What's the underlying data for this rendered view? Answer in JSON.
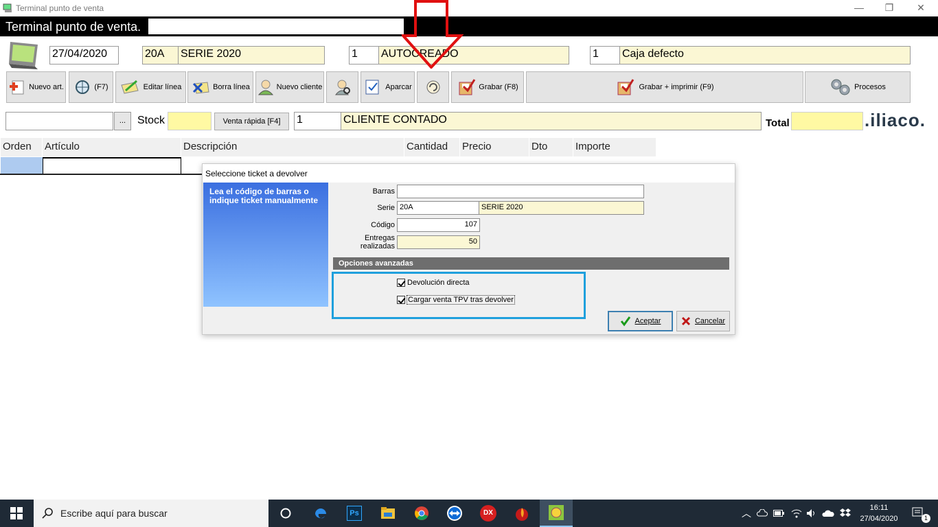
{
  "window": {
    "title": "Terminal punto de venta"
  },
  "header": {
    "title": "Terminal punto de venta."
  },
  "top_fields": {
    "date": "27/04/2020",
    "serie_code": "20A",
    "serie_name": "SERIE 2020",
    "user_code": "1",
    "user_name": "AUTOCREADO",
    "caja_code": "1",
    "caja_name": "Caja defecto"
  },
  "toolbar": {
    "nuevo_art": "Nuevo art.",
    "f7": "(F7)",
    "editar_linea": "Editar línea",
    "borra_linea": "Borra línea",
    "nuevo_cliente": "Nuevo cliente",
    "aparcar": "Aparcar",
    "grabar": "Grabar (F8)",
    "grabar_imprimir": "Grabar + imprimir (F9)",
    "procesos": "Procesos"
  },
  "row3": {
    "browse": "...",
    "stock_label": "Stock",
    "venta_rapida": "Venta rápida [F4]",
    "client_code": "1",
    "client_name": "CLIENTE CONTADO",
    "total_label": "Total",
    "logo": ".iliaco."
  },
  "grid": {
    "columns": [
      "Orden",
      "Artículo",
      "Descripción",
      "Cantidad",
      "Precio",
      "Dto",
      "Importe"
    ]
  },
  "dialog": {
    "title": "Seleccione ticket a devolver",
    "side_text": "Lea el código de barras o indique ticket manualmente",
    "barras_label": "Barras",
    "barras_value": "",
    "serie_label": "Serie",
    "serie_code": "20A",
    "serie_name": "SERIE 2020",
    "codigo_label": "Código",
    "codigo_value": "107",
    "entregas_label_1": "Entregas",
    "entregas_label_2": "realizadas",
    "entregas_value": "50",
    "advanced_header": "Opciones avanzadas",
    "opt_devolucion": "Devolución directa",
    "opt_cargar": "Cargar venta TPV tras devolver",
    "accept": "Aceptar",
    "cancel": "Cancelar"
  },
  "taskbar": {
    "search_placeholder": "Escribe aquí para buscar",
    "time": "16:11",
    "date": "27/04/2020",
    "notif_count": "1",
    "ps": "Ps",
    "dx": "DX"
  }
}
